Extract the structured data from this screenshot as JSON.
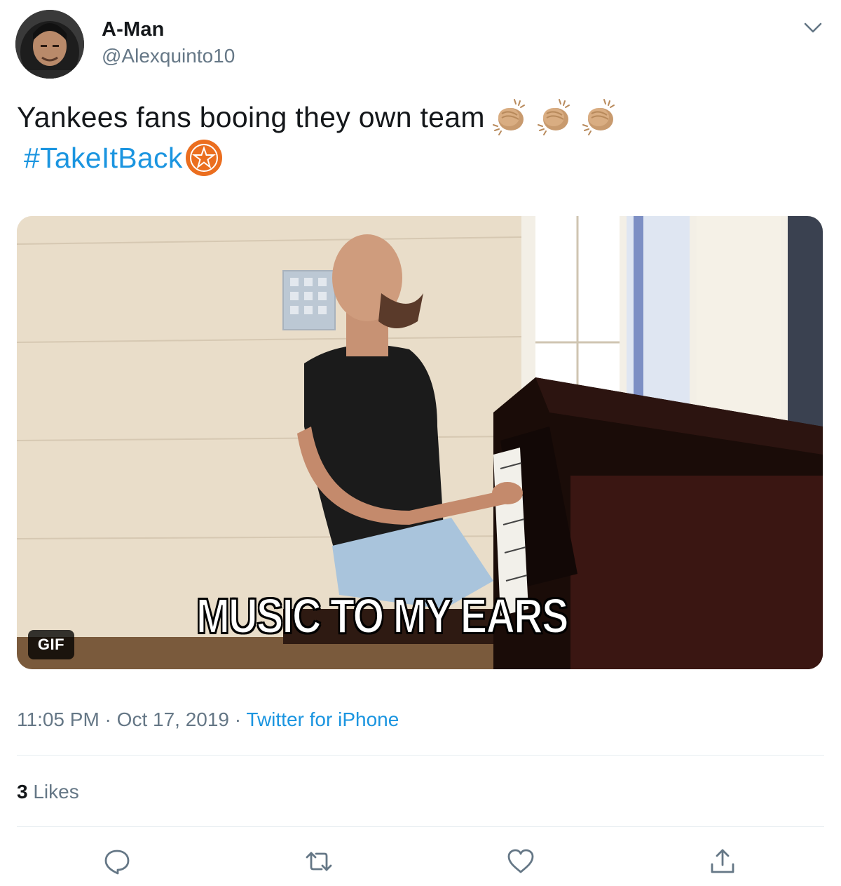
{
  "author": {
    "display_name": "A-Man",
    "handle": "@Alexquinto10"
  },
  "tweet": {
    "text": "Yankees fans booing they own team",
    "emojis": [
      "clapping-hands-emoji",
      "clapping-hands-emoji",
      "clapping-hands-emoji"
    ],
    "hashtag": "#TakeItBack",
    "hashtag_emoji": "astros-logo-emoji"
  },
  "media": {
    "caption": "MUSIC TO MY EARS",
    "badge": "GIF"
  },
  "meta": {
    "time": "11:05 PM",
    "separator": " · ",
    "date": "Oct 17, 2019",
    "source": "Twitter for iPhone"
  },
  "stats": {
    "likes_count": "3",
    "likes_label": " Likes"
  },
  "actions": [
    "reply-icon",
    "retweet-icon",
    "like-icon",
    "share-icon"
  ],
  "colors": {
    "link": "#1b95e0",
    "secondary_text": "#657786",
    "primary_text": "#14171a",
    "divider": "#e6ecf0"
  }
}
